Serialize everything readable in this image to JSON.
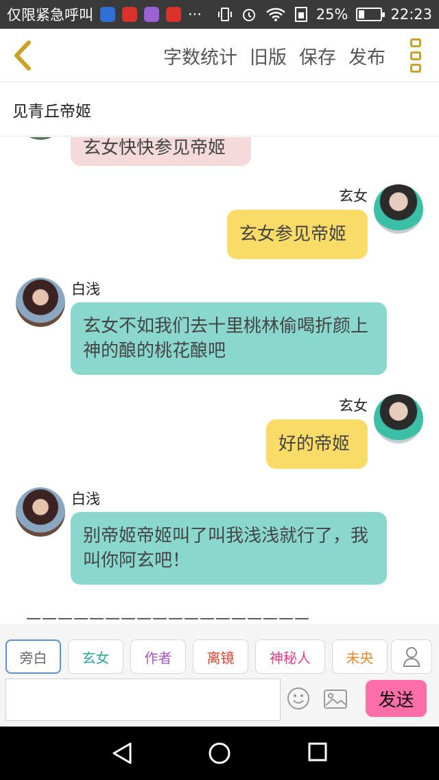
{
  "status": {
    "carrier": "仅限紧急呼叫",
    "more": "···",
    "battery": "25%",
    "battery_level": 0.25,
    "time": "22:23"
  },
  "header": {
    "actions": [
      "字数统计",
      "旧版",
      "保存",
      "发布"
    ]
  },
  "title": "见青丘帝姬",
  "messages": [
    {
      "side": "left",
      "color": "pink",
      "speaker": "",
      "text": "玄女快快参见帝姬"
    },
    {
      "side": "right",
      "color": "yellow",
      "speaker": "玄女",
      "text": "玄女参见帝姬"
    },
    {
      "side": "left",
      "color": "teal",
      "speaker": "白浅",
      "text": "玄女不如我们去十里桃林偷喝折颜上神的酿的桃花酿吧"
    },
    {
      "side": "right",
      "color": "yellow",
      "speaker": "玄女",
      "text": "好的帝姬"
    },
    {
      "side": "left",
      "color": "teal",
      "speaker": "白浅",
      "text": "别帝姬帝姬叫了叫我浅浅就行了，我叫你阿玄吧！"
    }
  ],
  "separator": "——————————————————",
  "roles": [
    {
      "label": "旁白",
      "color": "#666666"
    },
    {
      "label": "玄女",
      "color": "#2aa79a"
    },
    {
      "label": "作者",
      "color": "#a257c9"
    },
    {
      "label": "离镜",
      "color": "#d9402f"
    },
    {
      "label": "神秘人",
      "color": "#e03c86"
    },
    {
      "label": "未央",
      "color": "#e8892a"
    }
  ],
  "input": {
    "placeholder": ""
  },
  "send": "发送",
  "colors": {
    "pink_bubble": "#f4dada",
    "yellow_bubble": "#f9dc68",
    "teal_bubble": "#8ad8cd",
    "send": "#ff6fa7",
    "accent": "#c9a227"
  }
}
